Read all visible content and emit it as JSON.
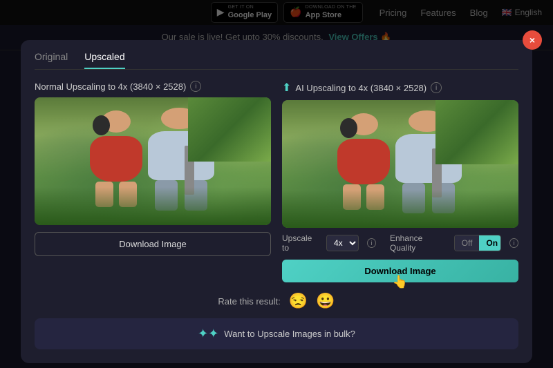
{
  "nav": {
    "google_play_sub": "GET IT ON",
    "google_play_name": "Google Play",
    "app_store_sub": "Download on the",
    "app_store_name": "App Store",
    "links": [
      "Pricing",
      "Features",
      "Blog"
    ],
    "language": "English"
  },
  "banner": {
    "text": "Our sale is live! Get upto 30% discounts.",
    "cta": "View Offers",
    "emoji": "🔥"
  },
  "tabs": {
    "original_label": "Original",
    "upscaled_label": "Upscaled"
  },
  "normal_col": {
    "label": "Normal Upscaling to 4x (3840 × 2528)",
    "download_label": "Download Image"
  },
  "ai_col": {
    "label": "AI Upscaling to 4x (3840 × 2528)",
    "download_label": "Download Image",
    "upscale_to_label": "Upscale to",
    "upscale_value": "4x",
    "enhance_quality_label": "Enhance Quality",
    "toggle_off": "Off",
    "toggle_on": "On"
  },
  "rating": {
    "label": "Rate this result:",
    "sad_emoji": "😒",
    "happy_emoji": "😀"
  },
  "bulk": {
    "text": "Want to Upscale Images in bulk?"
  },
  "close_icon": "×"
}
